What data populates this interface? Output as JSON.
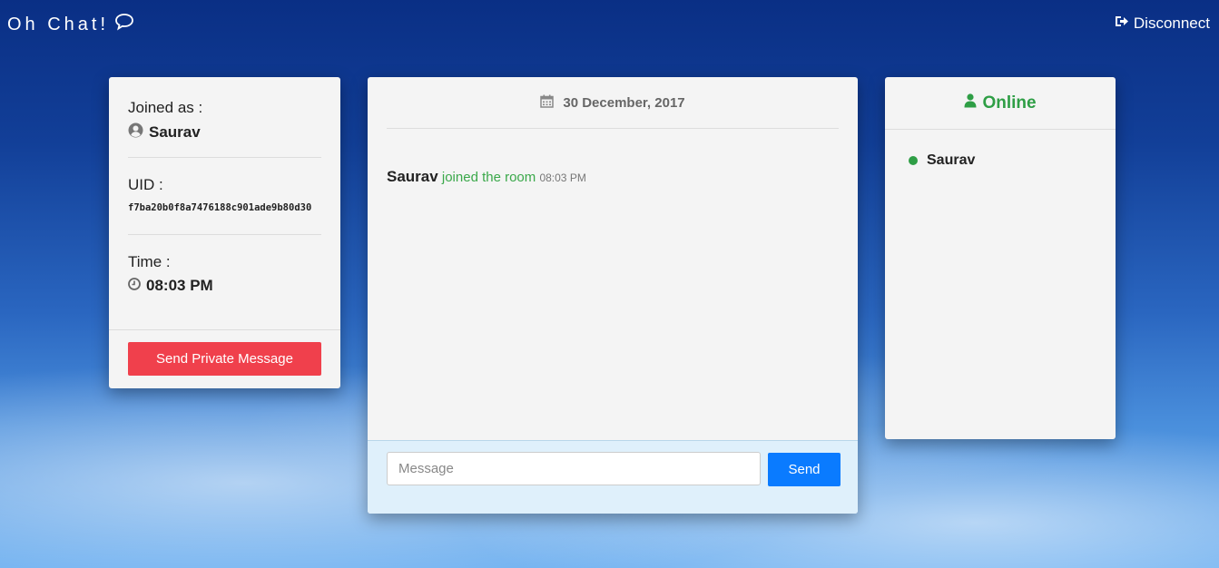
{
  "app": {
    "title": "Oh Chat!",
    "disconnect_label": "Disconnect"
  },
  "profile": {
    "joined_label": "Joined as :",
    "username": "Saurav",
    "uid_label": "UID :",
    "uid": "f7ba20b0f8a7476188c901ade9b80d30",
    "time_label": "Time :",
    "time": "08:03 PM",
    "private_button_label": "Send Private Message"
  },
  "chat": {
    "date": "30 December, 2017",
    "messages": [
      {
        "user": "Saurav",
        "text": "joined the room",
        "time": "08:03 PM"
      }
    ],
    "input_placeholder": "Message",
    "input_value": "",
    "send_label": "Send"
  },
  "online": {
    "header": "Online",
    "users": [
      "Saurav"
    ]
  },
  "colors": {
    "accent_green": "#2e9e45",
    "danger_red": "#f0404c",
    "primary_blue": "#0a7bff"
  }
}
